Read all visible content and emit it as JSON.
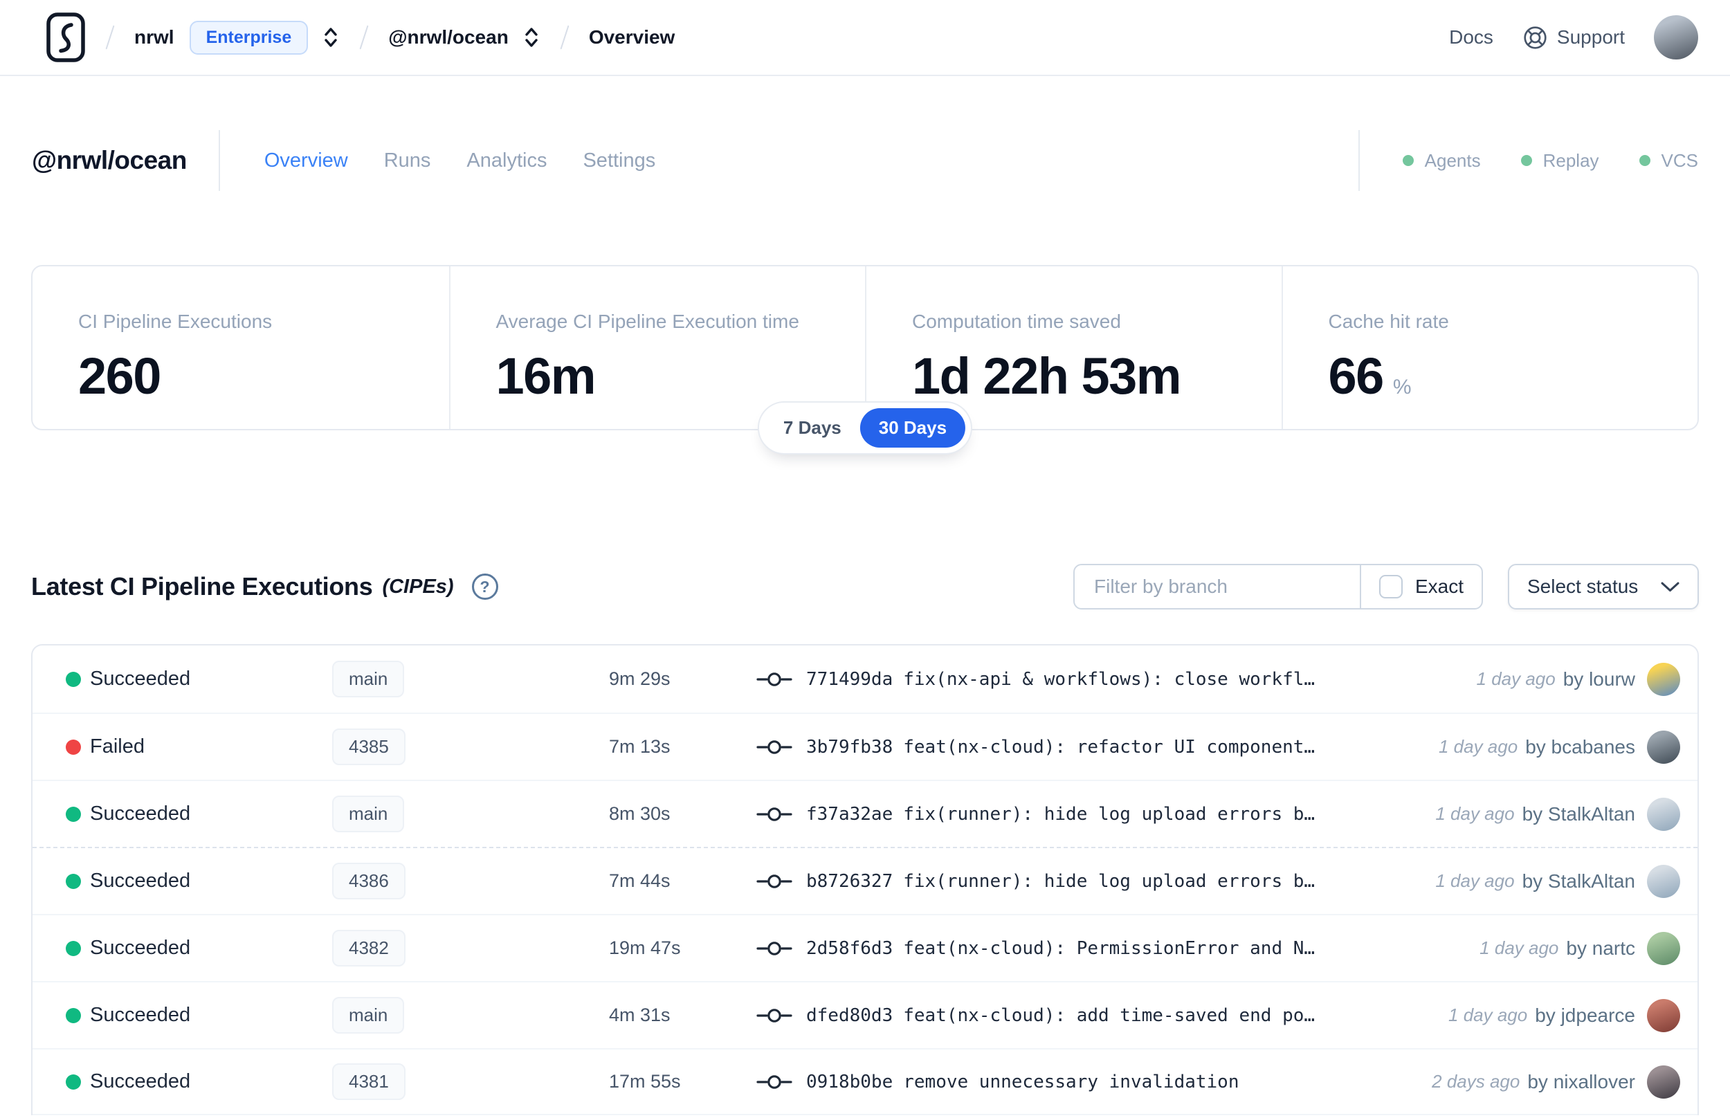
{
  "nav": {
    "breadcrumb": {
      "org": "nrwl",
      "plan_badge": "Enterprise",
      "workspace": "@nrwl/ocean",
      "page": "Overview"
    },
    "docs_label": "Docs",
    "support_label": "Support",
    "avatar": [
      "#b7c0cb",
      "#4e5660"
    ]
  },
  "header": {
    "workspace": "@nrwl/ocean",
    "tabs": [
      {
        "label": "Overview",
        "active": true
      },
      {
        "label": "Runs",
        "active": false
      },
      {
        "label": "Analytics",
        "active": false
      },
      {
        "label": "Settings",
        "active": false
      }
    ],
    "statuses": [
      {
        "label": "Agents"
      },
      {
        "label": "Replay"
      },
      {
        "label": "VCS"
      }
    ]
  },
  "stats": {
    "cards": [
      {
        "label": "CI Pipeline Executions",
        "value": "260"
      },
      {
        "label": "Average CI Pipeline Execution time",
        "value": "16m"
      },
      {
        "label": "Computation time saved",
        "value": "1d 22h 53m"
      },
      {
        "label": "Cache hit rate",
        "value": "66",
        "suffix": "%"
      }
    ]
  },
  "range_toggle": {
    "options": [
      {
        "label": "7 Days",
        "active": false
      },
      {
        "label": "30 Days",
        "active": true
      }
    ]
  },
  "section": {
    "title": "Latest CI Pipeline Executions",
    "subtitle": "(CIPEs)",
    "help_glyph": "?"
  },
  "filters": {
    "placeholder": "Filter by branch",
    "exact_label": "Exact",
    "select_label": "Select status"
  },
  "table": {
    "rows": [
      {
        "status": "Succeeded",
        "status_color": "#10b981",
        "branch": "main",
        "duration": "9m 29s",
        "hash": "771499da",
        "message": "fix(nx-api & workflows): close workfl…",
        "time": "1 day ago",
        "author": "by lourw",
        "avatar": [
          "#f7d354",
          "#5b8ac2"
        ]
      },
      {
        "status": "Failed",
        "status_color": "#ef4444",
        "branch": "4385",
        "duration": "7m 13s",
        "hash": "3b79fb38",
        "message": "feat(nx-cloud): refactor UI component…",
        "time": "1 day ago",
        "author": "by bcabanes",
        "avatar": [
          "#9aa4ad",
          "#3f4a54"
        ]
      },
      {
        "status": "Succeeded",
        "status_color": "#10b981",
        "branch": "main",
        "duration": "8m 30s",
        "hash": "f37a32ae",
        "message": "fix(runner): hide log upload errors b…",
        "time": "1 day ago",
        "author": "by StalkAltan",
        "avatar": [
          "#d6dde4",
          "#8fa6ba"
        ]
      },
      {
        "status": "Succeeded",
        "status_color": "#10b981",
        "branch": "4386",
        "duration": "7m 44s",
        "hash": "b8726327",
        "message": "fix(runner): hide log upload errors b…",
        "time": "1 day ago",
        "author": "by StalkAltan",
        "avatar": [
          "#d6dde4",
          "#8fa6ba"
        ],
        "divider_dashed": true
      },
      {
        "status": "Succeeded",
        "status_color": "#10b981",
        "branch": "4382",
        "duration": "19m 47s",
        "hash": "2d58f6d3",
        "message": "feat(nx-cloud): PermissionError and N…",
        "time": "1 day ago",
        "author": "by nartc",
        "avatar": [
          "#a8c9a0",
          "#5c8a67"
        ]
      },
      {
        "status": "Succeeded",
        "status_color": "#10b981",
        "branch": "main",
        "duration": "4m 31s",
        "hash": "dfed80d3",
        "message": "feat(nx-cloud): add time-saved end po…",
        "time": "1 day ago",
        "author": "by jdpearce",
        "avatar": [
          "#c97b6b",
          "#7e3b34"
        ]
      },
      {
        "status": "Succeeded",
        "status_color": "#10b981",
        "branch": "4381",
        "duration": "17m 55s",
        "hash": "0918b0be",
        "message": "remove unnecessary invalidation",
        "time": "2 days ago",
        "author": "by nixallover",
        "avatar": [
          "#9b8f93",
          "#3e3a42"
        ]
      }
    ]
  },
  "colors": {
    "accent": "#2563eb",
    "tab_active": "#3b82f6",
    "success": "#10b981",
    "failure": "#ef4444",
    "header_dot": "#74c69d"
  }
}
